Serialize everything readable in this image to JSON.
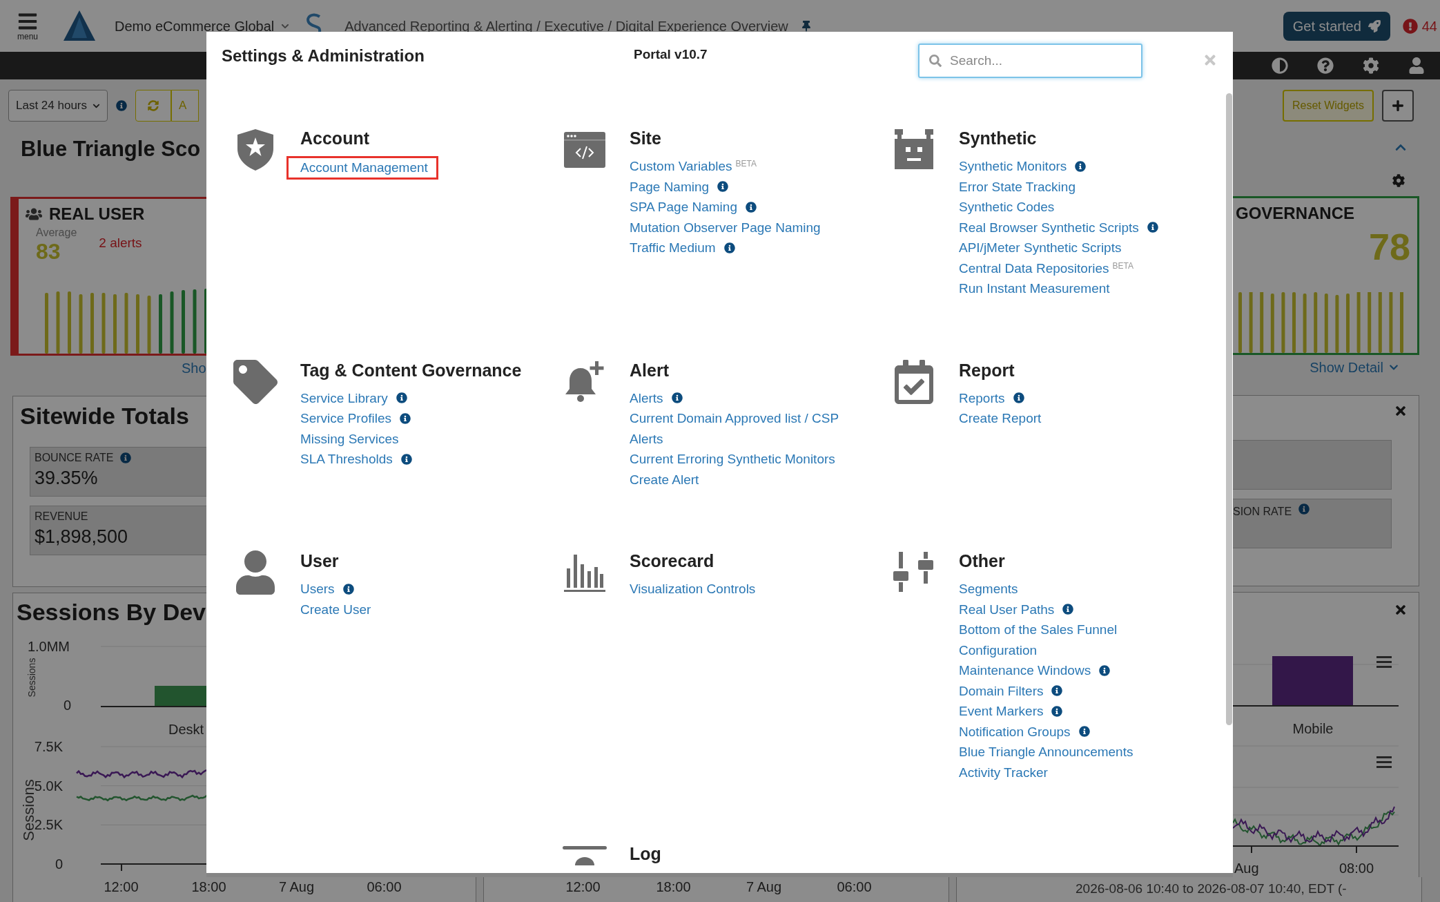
{
  "topbar": {
    "menu_label": "menu",
    "account": "Demo eCommerce Global",
    "breadcrumb": "Advanced Reporting & Alerting / Executive / Digital Experience Overview",
    "get_started": "Get started",
    "alert_count": "44"
  },
  "toolbar": {
    "time_range": "Last 24 hours",
    "cut_button": "A",
    "reset_button": "Reset Widgets"
  },
  "left": {
    "title": "Blue Triangle Sco",
    "real_user": {
      "title": "REAL USER",
      "average_label": "Average",
      "average": "83",
      "alerts": "2 alerts"
    },
    "show_link": "Sho",
    "totals": {
      "title": "Sitewide Totals",
      "metrics": [
        {
          "label": "BOUNCE RATE",
          "info": true,
          "value": "39.35%"
        },
        {
          "label": "REVENUE",
          "info": false,
          "value": "$1,898,500"
        }
      ]
    },
    "sessions": {
      "title": "Sessions By Dev",
      "bar_axis_title": "Sessions",
      "bar_ticks": [
        "1.0MM",
        "0"
      ],
      "bar_category": "Deskt",
      "line_axis_title": "Sessions",
      "line_ticks": [
        "7.5K",
        "5.0K",
        "2.5K",
        "0"
      ],
      "x_labels": [
        "12:00",
        "18:00",
        "7 Aug",
        "06:00"
      ]
    }
  },
  "middle": {
    "x_labels": [
      "12:00",
      "18:00",
      "7 Aug",
      "06:00"
    ]
  },
  "right": {
    "governance": {
      "title": "GOVERNANCE",
      "score": "78"
    },
    "show_detail": "Show Detail",
    "conversion_label": "SION RATE",
    "conversion_info": true,
    "bar_category": "Mobile",
    "x_labels": [
      "Aug",
      "08:00"
    ],
    "range": "2026-08-06 10:40 to 2026-08-07 10:40, EDT (-"
  },
  "modal": {
    "title": "Settings & Administration",
    "version": "Portal v10.7",
    "search": {
      "placeholder": "Search..."
    },
    "sections": [
      {
        "kind": "account",
        "title": "Account",
        "links": [
          {
            "label": "Account Management",
            "info": false,
            "highlighted": true
          }
        ]
      },
      {
        "kind": "site",
        "title": "Site",
        "links": [
          {
            "label": "Custom Variables",
            "badge": "BETA",
            "info": false,
            "highlighted": false
          },
          {
            "label": "Page Naming",
            "info": true,
            "highlighted": false
          },
          {
            "label": "SPA Page Naming",
            "info": true,
            "highlighted": false
          },
          {
            "label": "Mutation Observer Page Naming",
            "info": false,
            "highlighted": false
          },
          {
            "label": "Traffic Medium",
            "info": true,
            "highlighted": false
          }
        ]
      },
      {
        "kind": "synthetic",
        "title": "Synthetic",
        "links": [
          {
            "label": "Synthetic Monitors",
            "info": true,
            "highlighted": false
          },
          {
            "label": "Error State Tracking",
            "info": false,
            "highlighted": false
          },
          {
            "label": "Synthetic Codes",
            "info": false,
            "highlighted": false
          },
          {
            "label": "Real Browser Synthetic Scripts",
            "info": true,
            "highlighted": false
          },
          {
            "label": "API/jMeter Synthetic Scripts",
            "info": false,
            "highlighted": false
          },
          {
            "label": "Central Data Repositories",
            "badge": "BETA",
            "info": false,
            "highlighted": false
          },
          {
            "label": "Run Instant Measurement",
            "info": false,
            "highlighted": false
          }
        ]
      },
      {
        "kind": "tag",
        "title": "Tag & Content Governance",
        "links": [
          {
            "label": "Service Library",
            "info": true,
            "highlighted": false
          },
          {
            "label": "Service Profiles",
            "info": true,
            "highlighted": false
          },
          {
            "label": "Missing Services",
            "info": false,
            "highlighted": false
          },
          {
            "label": "SLA Thresholds",
            "info": true,
            "highlighted": false
          }
        ]
      },
      {
        "kind": "alert",
        "title": "Alert",
        "links": [
          {
            "label": "Alerts",
            "info": true,
            "highlighted": false
          },
          {
            "label": "Current Domain Approved list / CSP Alerts",
            "info": false,
            "highlighted": false
          },
          {
            "label": "Current Erroring Synthetic Monitors",
            "info": false,
            "highlighted": false
          },
          {
            "label": "Create Alert",
            "info": false,
            "highlighted": false
          }
        ]
      },
      {
        "kind": "report",
        "title": "Report",
        "links": [
          {
            "label": "Reports",
            "info": true,
            "highlighted": false
          },
          {
            "label": "Create Report",
            "info": false,
            "highlighted": false
          }
        ]
      },
      {
        "kind": "user",
        "title": "User",
        "links": [
          {
            "label": "Users",
            "info": true,
            "highlighted": false
          },
          {
            "label": "Create User",
            "info": false,
            "highlighted": false
          }
        ]
      },
      {
        "kind": "scorecard",
        "title": "Scorecard",
        "links": [
          {
            "label": "Visualization Controls",
            "info": false,
            "highlighted": false
          }
        ]
      },
      {
        "kind": "other",
        "title": "Other",
        "links": [
          {
            "label": "Segments",
            "info": false,
            "highlighted": false
          },
          {
            "label": "Real User Paths",
            "info": true,
            "highlighted": false
          },
          {
            "label": "Bottom of the Sales Funnel Configuration",
            "info": false,
            "highlighted": false
          },
          {
            "label": "Maintenance Windows",
            "info": true,
            "highlighted": false
          },
          {
            "label": "Domain Filters",
            "info": true,
            "highlighted": false
          },
          {
            "label": "Event Markers",
            "info": true,
            "highlighted": false
          },
          {
            "label": "Notification Groups",
            "info": true,
            "highlighted": false
          },
          {
            "label": "Blue Triangle Announcements",
            "info": false,
            "highlighted": false
          },
          {
            "label": "Activity Tracker",
            "info": false,
            "highlighted": false
          }
        ]
      }
    ],
    "partial_section": {
      "kind": "log",
      "title": "Log"
    }
  }
}
